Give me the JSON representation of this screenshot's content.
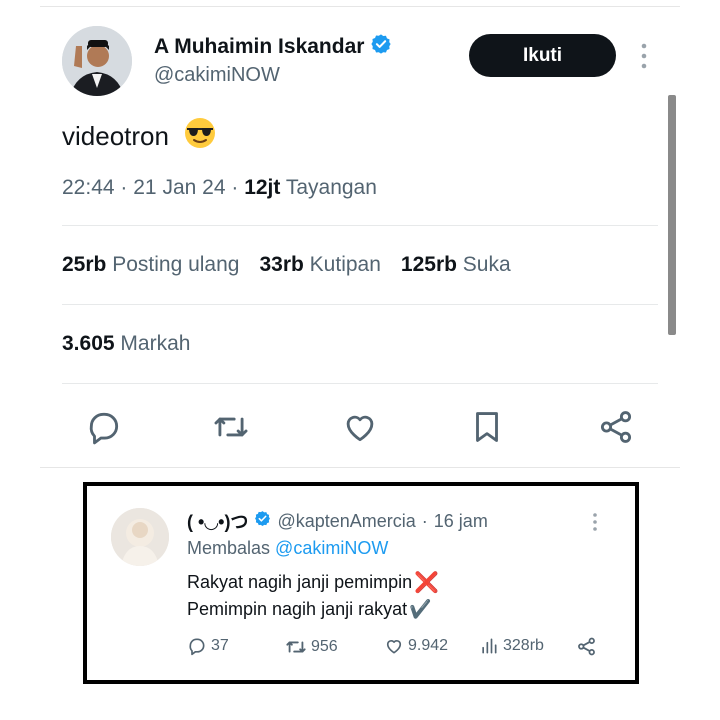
{
  "author": {
    "name": "A Muhaimin Iskandar",
    "handle": "@cakimiNOW",
    "verified": true,
    "follow_label": "Ikuti"
  },
  "tweet": {
    "text": "videotron",
    "emoji": "😎",
    "time": "22:44",
    "separator1": "·",
    "date": "21 Jan 24",
    "separator2": "·",
    "views_count": "12jt",
    "views_label": "Tayangan"
  },
  "stats": {
    "reposts_count": "25rb",
    "reposts_label": "Posting ulang",
    "quotes_count": "33rb",
    "quotes_label": "Kutipan",
    "likes_count": "125rb",
    "likes_label": "Suka",
    "bookmarks_count": "3.605",
    "bookmarks_label": "Markah"
  },
  "actions": [
    "reply-icon",
    "repost-icon",
    "like-icon",
    "bookmark-icon",
    "share-icon"
  ],
  "reply": {
    "name": "( •◡•)つ",
    "handle": "@kaptenAmercia",
    "separator": "·",
    "time": "16 jam",
    "replying_prefix": "Membalas",
    "replying_to": "@cakimiNOW",
    "line1": "Rakyat nagih janji pemimpin",
    "line1_mark": "❌",
    "line2": "Pemimpin nagih janji rakyat",
    "line2_mark": "✔️",
    "replies": "37",
    "reposts": "956",
    "likes": "9.942",
    "views": "328rb"
  },
  "colors": {
    "verified": "#1d9bf0",
    "text_primary": "#0f1419",
    "text_secondary": "#536471",
    "button_bg": "#0f1419",
    "highlight_border": "#000000",
    "x_mark": "#e0282e"
  }
}
